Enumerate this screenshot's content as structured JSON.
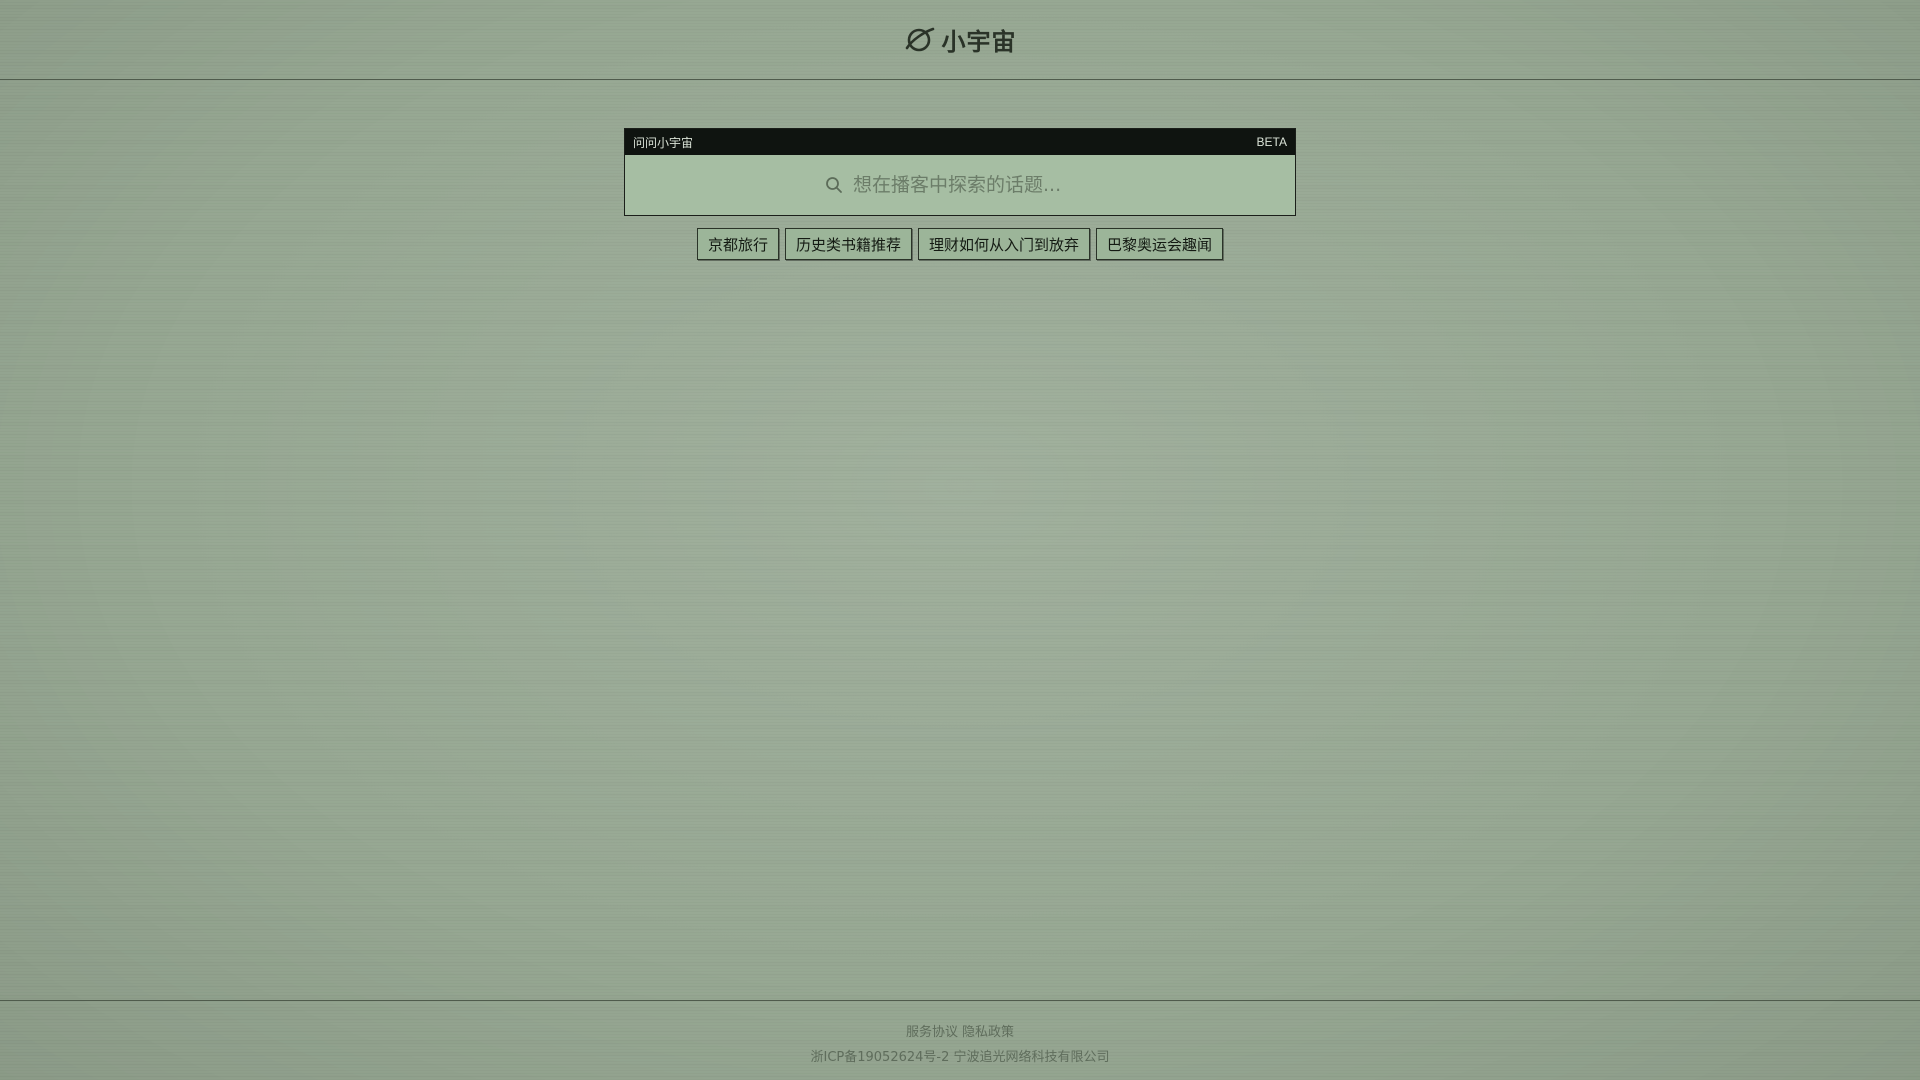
{
  "header": {
    "logo_icon": "planet-icon",
    "logo_text": "小宇宙"
  },
  "ask": {
    "title": "问问小宇宙",
    "badge": "BETA",
    "search_icon": "search-icon",
    "placeholder": "想在播客中探索的话题..."
  },
  "suggestions": [
    "京都旅行",
    "历史类书籍推荐",
    "理财如何从入门到放弃",
    "巴黎奥运会趣闻"
  ],
  "footer": {
    "terms": "服务协议",
    "privacy": "隐私政策",
    "icp": "浙ICP备19052624号-2 宁波追光网络科技有限公司"
  },
  "colors": {
    "background": "#97a893",
    "panel_bar": "#0f1410",
    "panel_body": "#a6bea3",
    "chip_bg": "#9cb599",
    "text_dark": "#1d241c"
  }
}
